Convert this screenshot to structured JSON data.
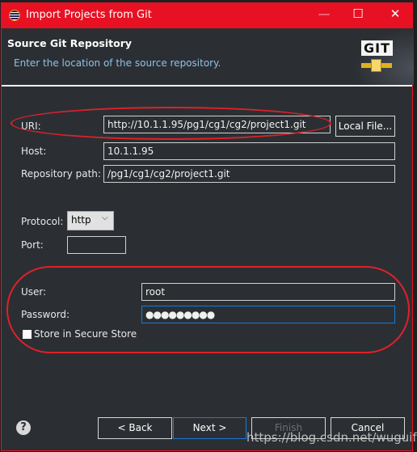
{
  "window": {
    "title": "Import Projects from Git",
    "minimize": "—",
    "maximize": "☐",
    "close": "✕"
  },
  "header": {
    "title": "Source Git Repository",
    "subtitle": "Enter the location of the source repository.",
    "logo_text": "GIT"
  },
  "form": {
    "uri_label": "URI:",
    "uri_value": "http://10.1.1.95/pg1/cg1/cg2/project1.git",
    "local_file_label": "Local File...",
    "host_label": "Host:",
    "host_value": "10.1.1.95",
    "repo_path_label": "Repository path:",
    "repo_path_value": "/pg1/cg1/cg2/project1.git",
    "protocol_label": "Protocol:",
    "protocol_value": "http",
    "port_label": "Port:",
    "port_value": "",
    "user_label": "User:",
    "user_value": "root",
    "password_label": "Password:",
    "password_value": "●●●●●●●●●",
    "store_label": "Store in Secure Store",
    "store_checked": false
  },
  "footer": {
    "help": "?",
    "back": "< Back",
    "next": "Next >",
    "finish": "Finish",
    "cancel": "Cancel"
  },
  "watermark": "https://blog.csdn.net/wuguifa",
  "colors": {
    "titlebar": "#e81123",
    "annotation": "#e0202a",
    "focus": "#1a7ad8"
  }
}
